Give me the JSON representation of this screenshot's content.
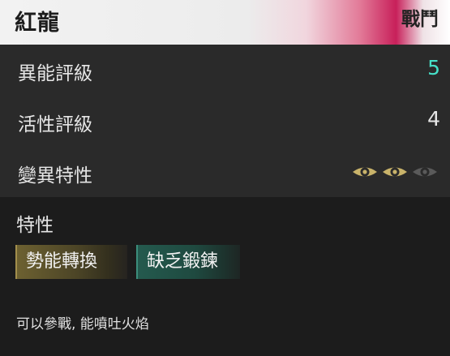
{
  "header": {
    "name": "紅龍",
    "category": "戰鬥"
  },
  "stats": [
    {
      "label": "異能評級",
      "value": "5"
    },
    {
      "label": "活性評級",
      "value": "4"
    },
    {
      "label": "變異特性",
      "eyes_filled": 2,
      "eyes_total": 3
    }
  ],
  "colors": {
    "highlight_value": "#46e0c8",
    "eye_filled": "#c9b36a",
    "eye_empty": "#5a5a5a"
  },
  "traits": {
    "title": "特性",
    "tags": [
      {
        "label": "勢能轉換",
        "style": "gold"
      },
      {
        "label": "缺乏鍛鍊",
        "style": "teal"
      }
    ]
  },
  "description": "可以參戰, 能噴吐火焰"
}
